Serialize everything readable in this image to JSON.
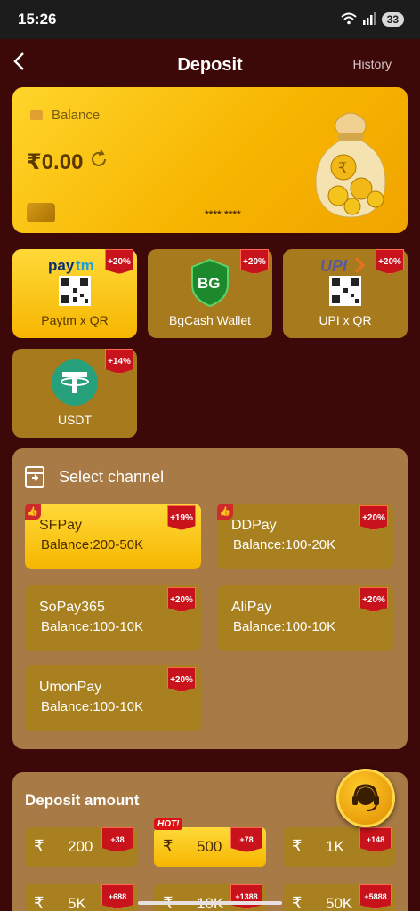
{
  "status_bar": {
    "time": "15:26",
    "battery": "33"
  },
  "header": {
    "title": "Deposit",
    "history": "History",
    "back_icon": "‹"
  },
  "balance_card": {
    "label": "Balance",
    "amount": "₹0.00",
    "masked_number": "**** ****"
  },
  "payment_methods": [
    {
      "label": "Paytm x QR",
      "bonus": "+20%",
      "logo_text": "Paytm",
      "icon": "paytm-qr-icon",
      "active": true
    },
    {
      "label": "BgCash Wallet",
      "bonus": "+20%",
      "logo_text": "BG",
      "icon": "bgcash-icon",
      "active": false
    },
    {
      "label": "UPI x QR",
      "bonus": "+20%",
      "logo_text": "UPI",
      "icon": "upi-qr-icon",
      "active": false
    },
    {
      "label": "USDT",
      "bonus": "+14%",
      "logo_text": "T",
      "icon": "tether-icon",
      "active": false
    }
  ],
  "channel": {
    "title": "Select channel",
    "items": [
      {
        "name": "SFPay",
        "range": "Balance:200-50K",
        "bonus": "+19%",
        "active": true,
        "recommended": true
      },
      {
        "name": "DDPay",
        "range": "Balance:100-20K",
        "bonus": "+20%",
        "active": false,
        "recommended": true
      },
      {
        "name": "SoPay365",
        "range": "Balance:100-10K",
        "bonus": "+20%",
        "active": false,
        "recommended": false
      },
      {
        "name": "AliPay",
        "range": "Balance:100-10K",
        "bonus": "+20%",
        "active": false,
        "recommended": false
      },
      {
        "name": "UmonPay",
        "range": "Balance:100-10K",
        "bonus": "+20%",
        "active": false,
        "recommended": false
      }
    ]
  },
  "amount": {
    "title": "Deposit amount",
    "currency": "₹",
    "hot_label": "HOT!",
    "options": [
      {
        "value": "200",
        "bonus": "+38",
        "active": false
      },
      {
        "value": "500",
        "bonus": "+78",
        "active": true,
        "hot": true
      },
      {
        "value": "1K",
        "bonus": "+148",
        "active": false
      },
      {
        "value": "5K",
        "bonus": "+688",
        "active": false
      },
      {
        "value": "10K",
        "bonus": "+1388",
        "active": false
      },
      {
        "value": "50K",
        "bonus": "+5888",
        "active": false
      }
    ]
  },
  "colors": {
    "background": "#3d0808",
    "accent": "#f6b600",
    "panel": "#a87a45",
    "badge": "#c8121c"
  }
}
